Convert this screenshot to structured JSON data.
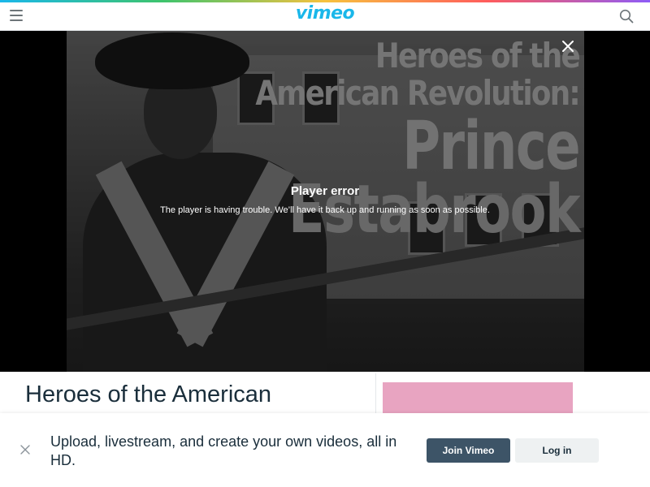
{
  "header": {
    "logo_text": "vimeo",
    "menu_icon": "hamburger-menu-icon",
    "search_icon": "search-icon",
    "accent_color": "#1ab7ea"
  },
  "player": {
    "video_overlay_title": [
      "Heroes of the",
      "American Revolution:",
      "Prince",
      "Estabrook"
    ],
    "error_title": "Player error",
    "error_message": "The player is having trouble. We’ll have it back up and running as soon as possible.",
    "close_icon": "close-icon"
  },
  "main": {
    "video_title": "Heroes of the American",
    "ad_color": "#e8a4c1"
  },
  "signup_banner": {
    "message": "Upload, livestream, and create your own videos, all in HD.",
    "join_label": "Join Vimeo",
    "login_label": "Log in",
    "join_color": "#3d5467",
    "close_icon": "close-icon"
  }
}
